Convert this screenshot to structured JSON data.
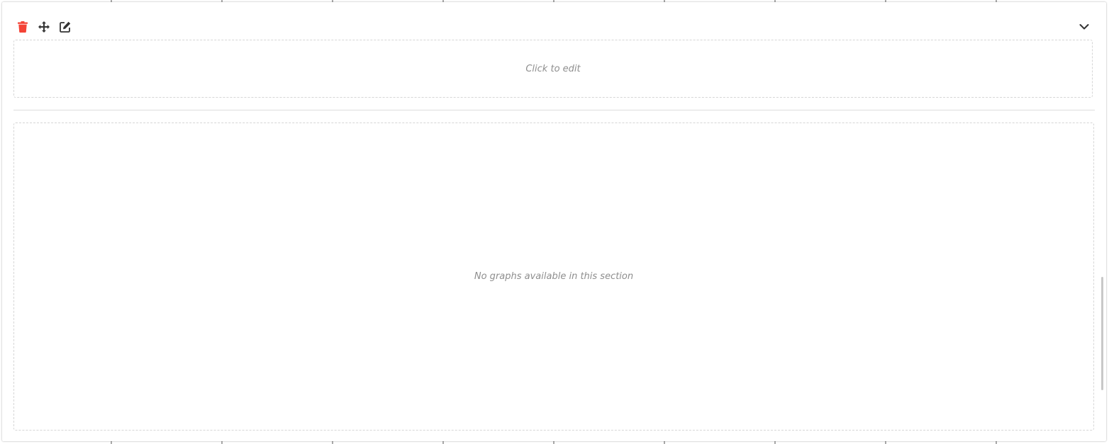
{
  "section": {
    "toolbar": {
      "delete_icon": "trash-icon",
      "move_icon": "move-arrows-icon",
      "edit_icon": "edit-square-icon",
      "collapse_icon": "chevron-down-icon"
    },
    "edit_placeholder": "Click to edit",
    "empty_graphs_message": "No graphs available in this section"
  },
  "colors": {
    "delete": "#f44336",
    "icon": "#333333",
    "muted_text": "#8e8e8e",
    "border": "#d6d6d6"
  }
}
